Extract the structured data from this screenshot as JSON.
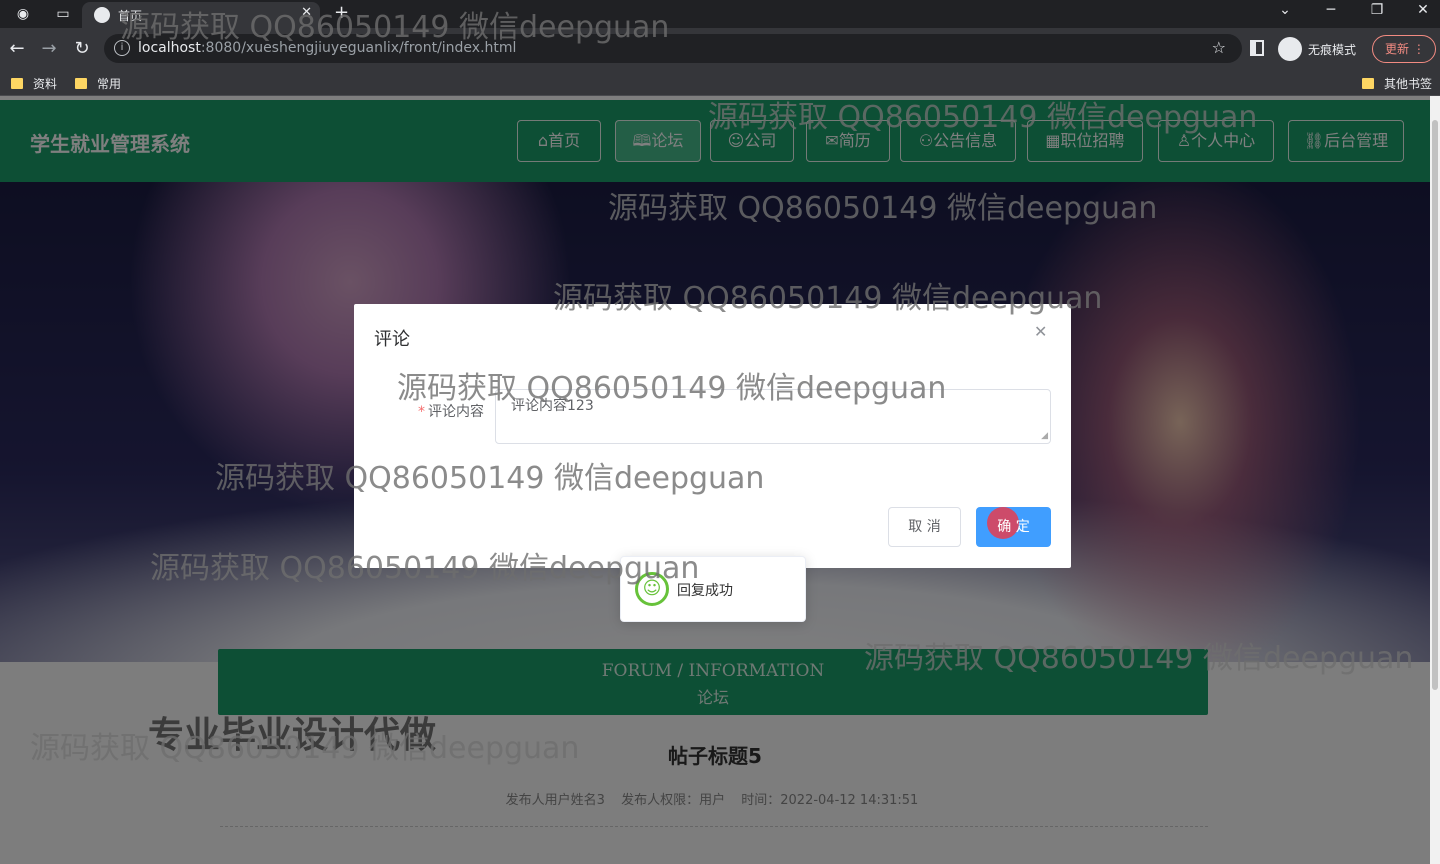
{
  "browser": {
    "tab_title": "首页",
    "new_tab": "+",
    "url_host": "localhost",
    "url_rest": ":8080/xueshengjiuyeguanlix/front/index.html",
    "incognito_label": "无痕模式",
    "update_label": "更新",
    "bookmarks": [
      "资料",
      "常用"
    ],
    "other_bookmarks": "其他书签"
  },
  "site": {
    "brand": "学生就业管理系统",
    "nav": [
      {
        "label": "首页",
        "icon": "home-icon"
      },
      {
        "label": "论坛",
        "icon": "book-icon",
        "active": true
      },
      {
        "label": "公司",
        "icon": "smile-icon"
      },
      {
        "label": "简历",
        "icon": "mail-icon"
      },
      {
        "label": "公告信息",
        "icon": "goods-icon"
      },
      {
        "label": "职位招聘",
        "icon": "grid-icon"
      },
      {
        "label": "个人中心",
        "icon": "user-icon"
      },
      {
        "label": "后台管理",
        "icon": "link-icon"
      }
    ],
    "accent": "#1b9e6b"
  },
  "section": {
    "title_en": "FORUM / INFORMATION",
    "title_cn": "论坛"
  },
  "post": {
    "title": "帖子标题5",
    "author": "发布人用户姓名3",
    "role": "发布人权限：用户",
    "time": "时间：2022-04-12 14:31:51"
  },
  "promo_text": "专业毕业设计代做",
  "dialog": {
    "title": "评论",
    "field_label": "评论内容",
    "required_mark": "*",
    "textarea_value": "评论内容123",
    "cancel_label": "取 消",
    "confirm_label": "确 定"
  },
  "toast": {
    "message": "回复成功"
  },
  "watermark": "源码获取 QQ86050149 微信deepguan"
}
